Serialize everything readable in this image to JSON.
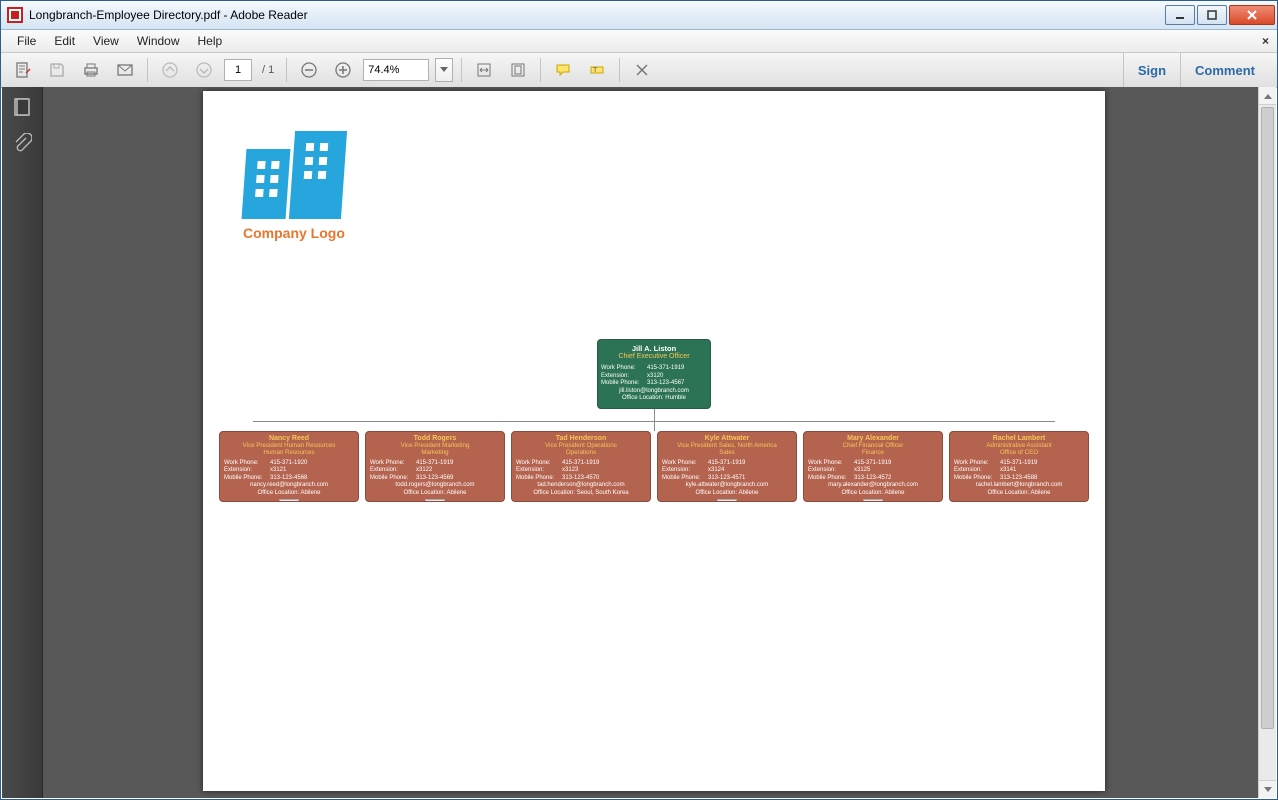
{
  "window": {
    "title": "Longbranch-Employee Directory.pdf - Adobe Reader"
  },
  "menu": {
    "file": "File",
    "edit": "Edit",
    "view": "View",
    "window": "Window",
    "help": "Help",
    "close_doc": "×"
  },
  "toolbar": {
    "page_current": "1",
    "page_sep": " / ",
    "page_total": "1",
    "zoom": "74.4%",
    "sign": "Sign",
    "comment": "Comment"
  },
  "doc": {
    "logo_caption": "Company Logo",
    "ceo": {
      "name": "Jill A. Liston",
      "title": "Chief Executive Officer",
      "work_phone": "415-371-1919",
      "extension": "x3120",
      "mobile": "313-123-4567",
      "email": "jill.liston@longbranch.com",
      "office": "Humble"
    },
    "labels": {
      "work_phone": "Work Phone:",
      "extension": "Extension:",
      "mobile": "Mobile Phone:",
      "office": "Office Location:"
    },
    "reports": [
      {
        "name": "Nancy Reed",
        "title": "Vice President Human Resources",
        "dept": "Human Resources",
        "work_phone": "415-371-1920",
        "extension": "x3121",
        "mobile": "313-123-4568",
        "email": "nancy.reed@longbranch.com",
        "office": "Abilene",
        "expand": true
      },
      {
        "name": "Todd Rogers",
        "title": "Vice President Marketing",
        "dept": "Marketing",
        "work_phone": "415-371-1919",
        "extension": "x3122",
        "mobile": "313-123-4569",
        "email": "todd.rogers@longbranch.com",
        "office": "Abilene",
        "expand": true
      },
      {
        "name": "Tad Henderson",
        "title": "Vice President Operations",
        "dept": "Operations",
        "work_phone": "415-371-1919",
        "extension": "x3123",
        "mobile": "313-123-4570",
        "email": "tad.henderson@longbranch.com",
        "office": "Seoul, South Korea",
        "expand": false
      },
      {
        "name": "Kyle Attwater",
        "title": "Vice President Sales, North America",
        "dept": "Sales",
        "work_phone": "415-371-1919",
        "extension": "x3124",
        "mobile": "313-123-4571",
        "email": "kyle.attwater@longbranch.com",
        "office": "Abilene",
        "expand": true
      },
      {
        "name": "Mary Alexander",
        "title": "Chief Financial Officer",
        "dept": "Finance",
        "work_phone": "415-371-1919",
        "extension": "x3125",
        "mobile": "313-123-4572",
        "email": "mary.alexander@longbranch.com",
        "office": "Abilene",
        "expand": true
      },
      {
        "name": "Rachel Lambert",
        "title": "Administrative Assistant",
        "dept": "Office of CEO",
        "work_phone": "415-371-1919",
        "extension": "x3141",
        "mobile": "313-123-4588",
        "email": "rachel.lambert@longbranch.com",
        "office": "Abilene",
        "expand": false
      }
    ]
  }
}
